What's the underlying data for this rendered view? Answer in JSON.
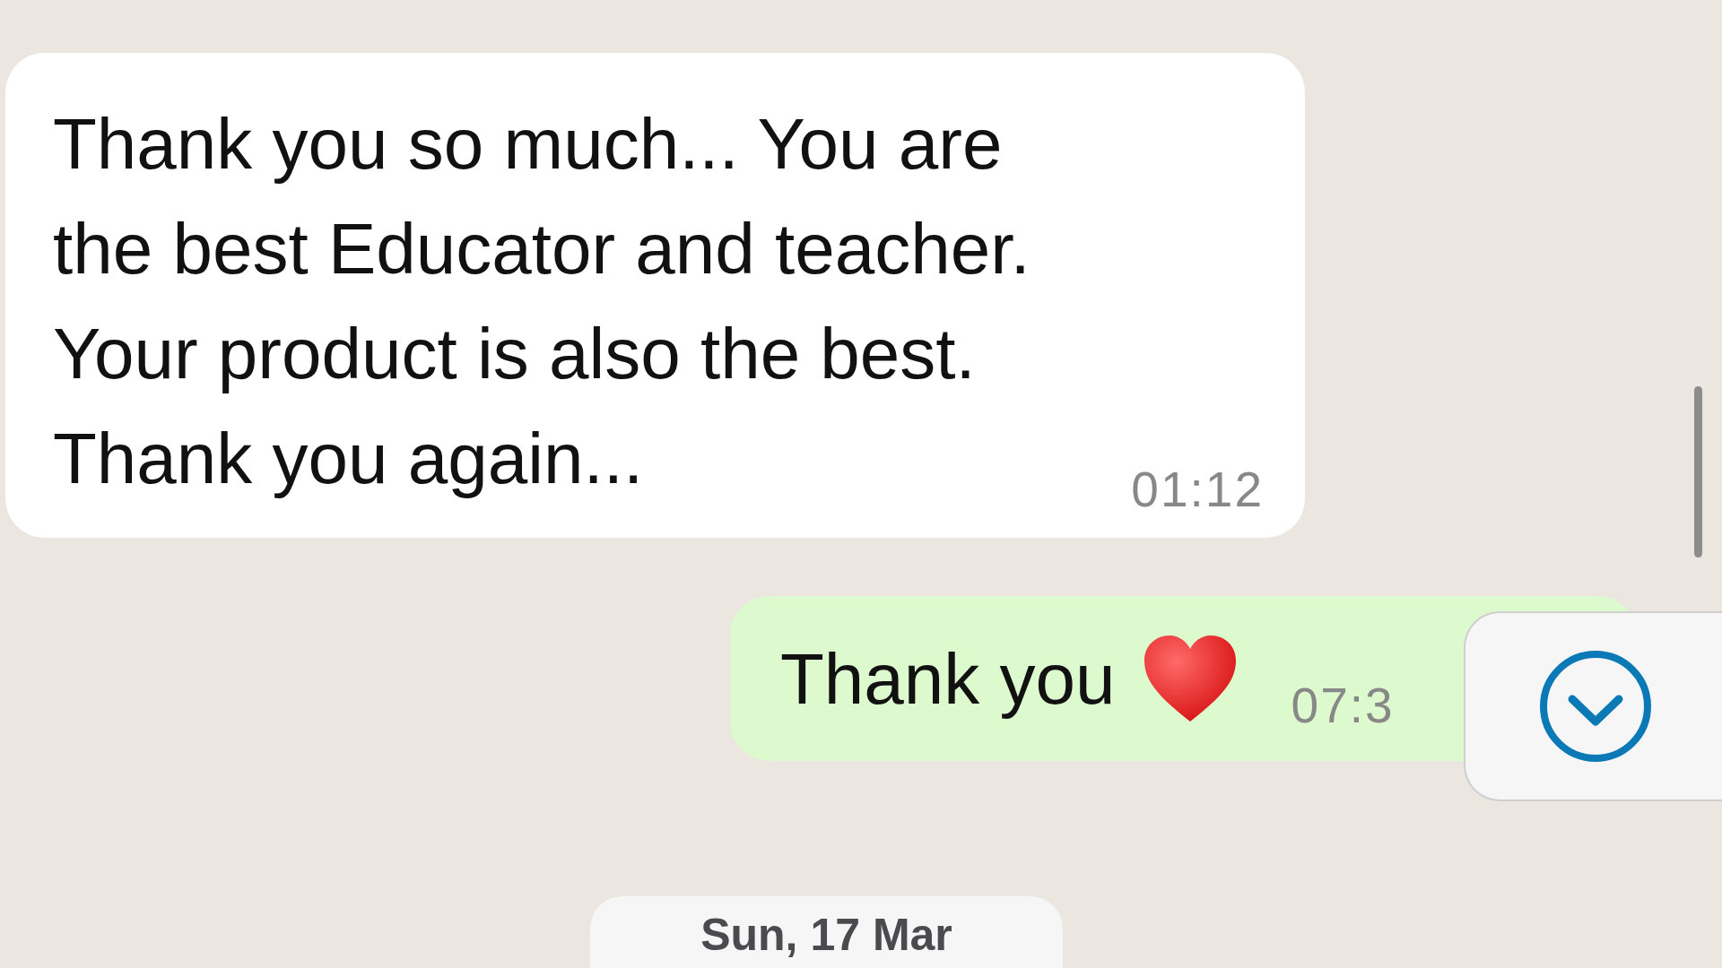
{
  "messages": [
    {
      "kind": "incoming",
      "text": "Thank you so much... You are the best Educator and teacher. Your product is also the best. Thank you again...",
      "time": "01:12"
    },
    {
      "kind": "outgoing",
      "text": "Thank you",
      "emoji": {
        "kind": "heart"
      },
      "time": "07:3"
    }
  ],
  "date_chip": "Sun, 17 Mar"
}
